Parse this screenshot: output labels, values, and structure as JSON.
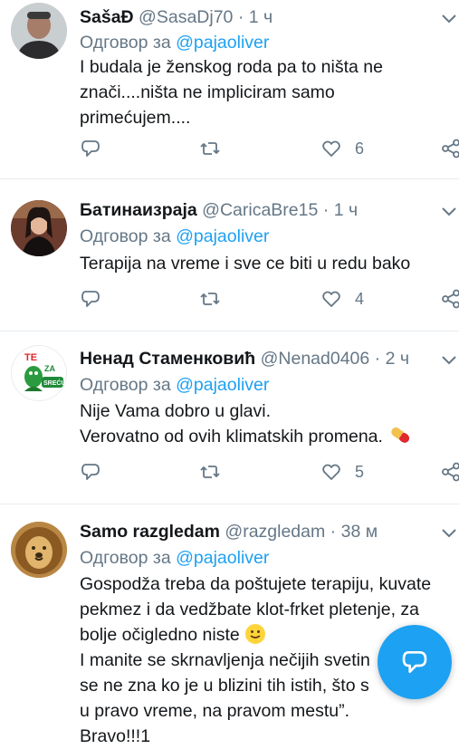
{
  "reply_prefix": "Одговор за",
  "tweets": [
    {
      "name": "SašaĐ",
      "handle": "@SasaDj70",
      "separator": "·",
      "time": "1 ч",
      "reply_to": "@pajaoliver",
      "text": "I budala je ženskog roda pa to ništa ne znači....ništa ne impliciram samo primećujem....",
      "likes": "6"
    },
    {
      "name": "Батинаизраја",
      "handle": "@CaricaBre15",
      "separator": "·",
      "time": "1 ч",
      "reply_to": "@pajaoliver",
      "text": "Terapija na vreme i sve ce biti u redu bako",
      "likes": "4"
    },
    {
      "name": "Ненад Стаменковић",
      "handle": "@Nenad0406",
      "separator": "·",
      "time": "2 ч",
      "reply_to": "@pajaoliver",
      "text_line1": "Nije Vama dobro u glavi.",
      "text_line2": "Verovatno od ovih klimatskih promena.",
      "avatar_text_top": "TE",
      "avatar_text_mid": "ZA",
      "avatar_text_bottom": "SREĆU",
      "likes": "5"
    },
    {
      "name": "Samo razgledam",
      "handle": "@razgledam",
      "separator": "·",
      "time": "38 м",
      "reply_to": "@pajaoliver",
      "text_line1": "Gospodža treba da poštujete terapiju, kuvate pekmez i da vedžbate klot-frket pletenje, za bolje očigledno niste",
      "text_line2": "I manite se skrnavljenja nečijih svetin",
      "text_line2b": "se ne zna ko je u blizini tih istih, što s",
      "text_line3": "u pravo vreme, na pravom mestu”.",
      "text_line4": "Bravo!!!1"
    }
  ],
  "colors": {
    "accent": "#1da1f2",
    "text": "#14171a",
    "muted": "#657786",
    "divider": "#e6ecf0"
  }
}
